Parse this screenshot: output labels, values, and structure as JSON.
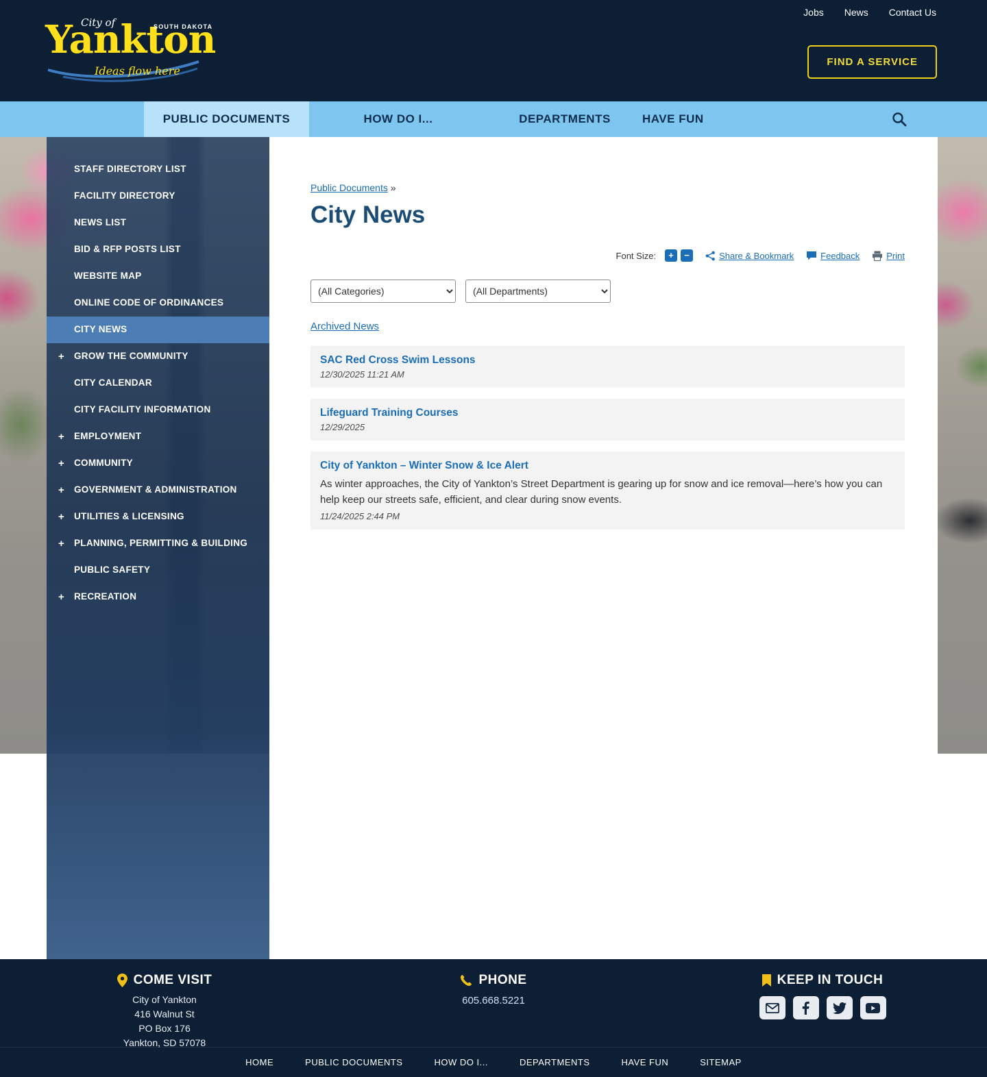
{
  "colors": {
    "header_navy": "#0d1f35",
    "nav_blue": "#7ec6f0",
    "nav_active_blue": "#b8e2f9",
    "sidebar_blue": "#1c385c",
    "sidebar_active": "#4c7eb5",
    "link_blue": "#1a6db6",
    "accent_yellow": "#f0d01a",
    "title_blue": "#1b4d74"
  },
  "header": {
    "logo": {
      "city_of": "City of",
      "name": "Yankton",
      "state": "SOUTH DAKOTA",
      "tagline": "Ideas flow here"
    },
    "top_links": [
      "Jobs",
      "News",
      "Contact Us"
    ],
    "find_service_label": "FIND A SERVICE"
  },
  "nav": {
    "items": [
      {
        "label": "PUBLIC DOCUMENTS",
        "cls": "active"
      },
      {
        "label": "HOW DO I...",
        "cls": ""
      },
      {
        "label": "DEPARTMENTS",
        "cls": ""
      },
      {
        "label": "HAVE FUN",
        "cls": ""
      }
    ]
  },
  "sidebar": {
    "items": [
      {
        "label": "STAFF DIRECTORY LIST",
        "prefix": "",
        "cls": ""
      },
      {
        "label": "FACILITY DIRECTORY",
        "prefix": "",
        "cls": ""
      },
      {
        "label": "NEWS LIST",
        "prefix": "",
        "cls": ""
      },
      {
        "label": "BID & RFP POSTS LIST",
        "prefix": "",
        "cls": ""
      },
      {
        "label": "WEBSITE MAP",
        "prefix": "",
        "cls": ""
      },
      {
        "label": "ONLINE CODE OF ORDINANCES",
        "prefix": "",
        "cls": ""
      },
      {
        "label": "CITY NEWS",
        "prefix": "",
        "cls": "active"
      },
      {
        "label": "GROW THE COMMUNITY",
        "prefix": "+",
        "cls": ""
      },
      {
        "label": "CITY CALENDAR",
        "prefix": "",
        "cls": ""
      },
      {
        "label": "CITY FACILITY INFORMATION",
        "prefix": "",
        "cls": ""
      },
      {
        "label": "EMPLOYMENT",
        "prefix": "+",
        "cls": ""
      },
      {
        "label": "COMMUNITY",
        "prefix": "+",
        "cls": ""
      },
      {
        "label": "GOVERNMENT & ADMINISTRATION",
        "prefix": "+",
        "cls": ""
      },
      {
        "label": "UTILITIES & LICENSING",
        "prefix": "+",
        "cls": ""
      },
      {
        "label": "PLANNING, PERMITTING & BUILDING",
        "prefix": "+",
        "cls": ""
      },
      {
        "label": "PUBLIC SAFETY",
        "prefix": "",
        "cls": ""
      },
      {
        "label": "RECREATION",
        "prefix": "+",
        "cls": ""
      }
    ]
  },
  "main": {
    "breadcrumb_link": "Public Documents",
    "breadcrumb_sep": "»",
    "title": "City News",
    "toolbar": {
      "font_size_label": "Font Size:",
      "increase": "+",
      "decrease": "−",
      "share_label": "Share & Bookmark",
      "feedback_label": "Feedback",
      "print_label": "Print"
    },
    "filters": {
      "categories": "(All Categories)",
      "departments": "(All Departments)"
    },
    "archived_label": "Archived News",
    "news": [
      {
        "title": "SAC Red Cross Swim Lessons",
        "description": "",
        "date": "12/30/2025 11:21 AM"
      },
      {
        "title": "Lifeguard Training Courses",
        "description": "",
        "date": "12/29/2025"
      },
      {
        "title": "City of Yankton – Winter Snow & Ice Alert",
        "description": "As winter approaches, the City of Yankton’s Street Department is gearing up for snow and ice removal—here’s how you can help keep our streets safe, efficient, and clear during snow events.",
        "date": "11/24/2025 2:44 PM"
      }
    ]
  },
  "footer": {
    "come_visit": {
      "heading": "COME VISIT",
      "lines": [
        "City of Yankton",
        "416 Walnut St",
        "PO Box 176",
        "Yankton, SD 57078"
      ]
    },
    "phone": {
      "heading": "PHONE",
      "number": "605.668.5221"
    },
    "keep_in_touch": {
      "heading": "KEEP IN TOUCH",
      "social_icons": [
        "email-icon",
        "facebook-icon",
        "twitter-icon",
        "youtube-icon"
      ]
    },
    "bottom_links": [
      "HOME",
      "PUBLIC DOCUMENTS",
      "HOW DO I...",
      "DEPARTMENTS",
      "HAVE FUN",
      "SITEMAP"
    ]
  }
}
